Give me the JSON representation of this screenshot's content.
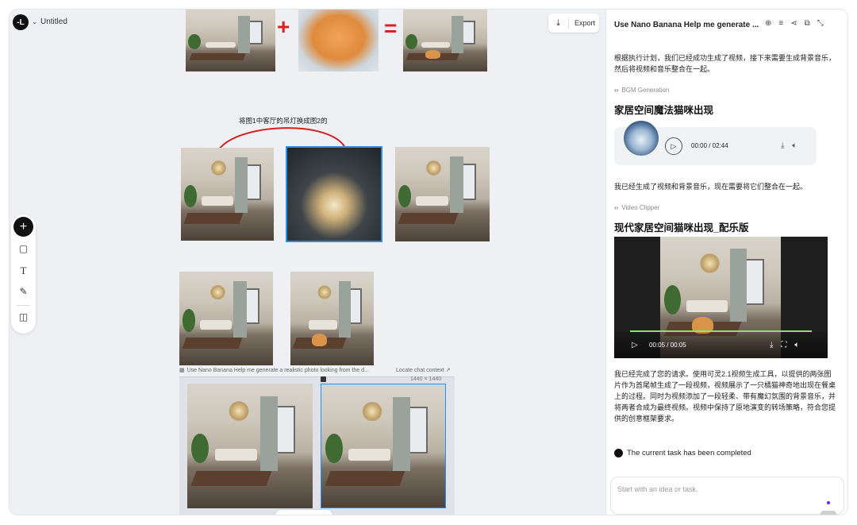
{
  "app": {
    "doc_title": "Untitled",
    "logo_text": "-L",
    "logo_chevron": "⌄"
  },
  "export": {
    "label": "Export",
    "icon": "download-icon",
    "icon_glyph": "⤓"
  },
  "toolbar": {
    "add_glyph": "+",
    "items": [
      "square-icon",
      "text-icon",
      "pencil-icon",
      "layout-icon"
    ]
  },
  "canvas": {
    "plus": "+",
    "equals": "=",
    "prompt_label": "将图1中客厅的吊灯换成图2的",
    "group_title": "Use Nano Banana Help me generate a realistic photo looking from the d...",
    "locate_link": "Locate chat context ↗",
    "dims": "1440 × 1440"
  },
  "panel": {
    "title": "Use Nano Banana Help me generate ...",
    "header_icons": [
      "new-chat-icon",
      "history-icon",
      "share-icon",
      "fullscreen-icon",
      "collapse-icon"
    ],
    "intro": "根据执行计划，我们已经成功生成了视频，接下来需要生成背景音乐，然后将视频和音乐整合在一起。",
    "bgm_tag": "BGM Generation",
    "bgm_heading": "家居空间魔法猫咪出现",
    "audio_time": "00:00 / 02:44",
    "mid_text": "我已经生成了视频和背景音乐，现在需要将它们整合在一起。",
    "clip_tag": "Video Clipper",
    "clip_heading": "现代家居空间猫咪出现_配乐版",
    "video_time": "00:05 / 00:05",
    "video_progress": 1.0,
    "summary": "我已经完成了您的请求。使用可灵2.1视频生成工具，以提供的两张图片作为首尾帧生成了一段视频，视频展示了一只橘猫神奇地出现在餐桌上的过程。同时为视频添加了一段轻柔、带有魔幻氛围的背景音乐，并将两者合成为最终视频。视频中保持了原地演变的转场策略，符合您提供的创意框架要求。",
    "done_text": "The current task has been completed",
    "input_placeholder": "Start with an idea or task.",
    "accent_color": "#5b2ee6",
    "progress_color": "#7ef05a"
  }
}
